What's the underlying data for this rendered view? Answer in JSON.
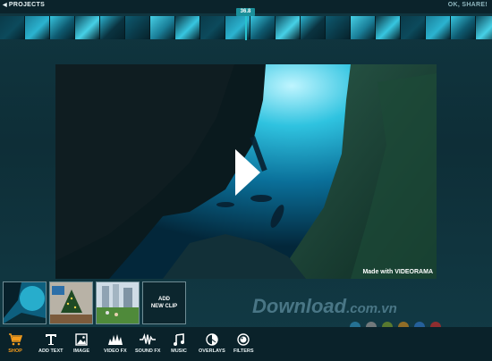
{
  "header": {
    "back_label": "PROJECTS",
    "share_label": "OK, SHARE!",
    "time_badge": "36.8"
  },
  "video": {
    "watermark": "Made with VIDEORAMA"
  },
  "clips": {
    "add_line1": "ADD",
    "add_line2": "NEW CLIP"
  },
  "toolbar": {
    "items": [
      {
        "label": "SHOP",
        "icon": "cart-icon",
        "active": true
      },
      {
        "label": "ADD TEXT",
        "icon": "text-icon"
      },
      {
        "label": "IMAGE",
        "icon": "image-icon"
      },
      {
        "label": "VIDEO FX",
        "icon": "video-fx-icon"
      },
      {
        "label": "SOUND FX",
        "icon": "sound-fx-icon"
      },
      {
        "label": "MUSIC",
        "icon": "music-icon"
      },
      {
        "label": "OVERLAYS",
        "icon": "overlays-icon"
      },
      {
        "label": "FILTERS",
        "icon": "filters-icon"
      }
    ]
  },
  "watermark_site": {
    "main": "Download",
    "domain": ".com.vn"
  },
  "colors": {
    "accent": "#f39b1c",
    "playhead": "#27c3cf",
    "badge": "#1b8f9a"
  }
}
